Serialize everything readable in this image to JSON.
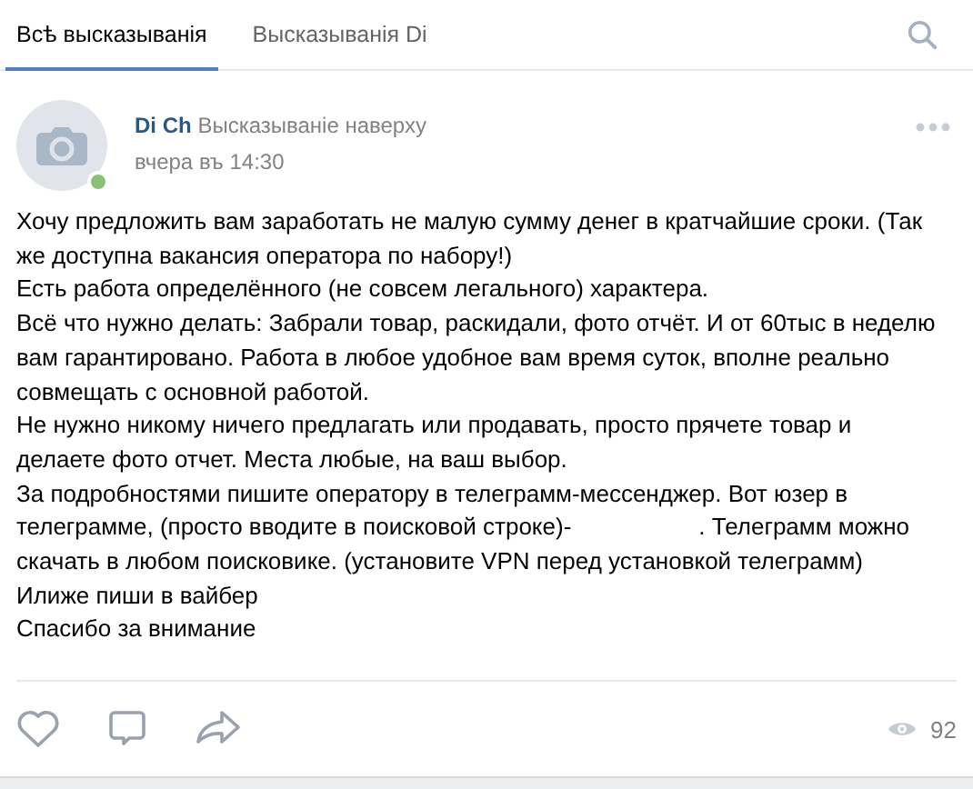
{
  "tabs": [
    {
      "label": "Всѣ высказыванія",
      "selected": true
    },
    {
      "label": "Высказыванія Di",
      "selected": false
    }
  ],
  "post": {
    "author": "Di Ch",
    "subtitle": "Высказываніе наверху",
    "time": "вчера въ 14:30",
    "online": true,
    "lines": [
      [
        "Хочу предложить вам заработать не малую сумму денег в кратчайшие сроки. (Так"
      ],
      [
        "же доступна вакансия оператора по набору!)"
      ],
      [
        "Есть работа определённого (не совсем легального) характера."
      ],
      [
        "Всё что нужно делать: Забрали товар, раскидали, фото отчёт. И от 60тыс в неделю"
      ],
      [
        "вам гарантировано. Работа в любое удобное вам время суток, вполне реально"
      ],
      [
        "совмещать с основной работой."
      ],
      [
        "Не нужно никому ничего предлагать или продавать, просто прячете товар и"
      ],
      [
        "делаете фото отчет. Места любые, на ваш выбор."
      ],
      [
        "За подробностями пишите оператору в телеграмм-мессенджер. Вот юзер в"
      ],
      [
        "телеграмме, (просто вводите в поисковой строке)-",
        ". Телеграмм можно"
      ],
      [
        "скачать в любом поисковике. (установите VPN перед установкой телеграмм)"
      ],
      [
        "Илиже пиши в вайбер"
      ],
      [
        "Спасибо за внимание"
      ]
    ],
    "views": "92"
  }
}
